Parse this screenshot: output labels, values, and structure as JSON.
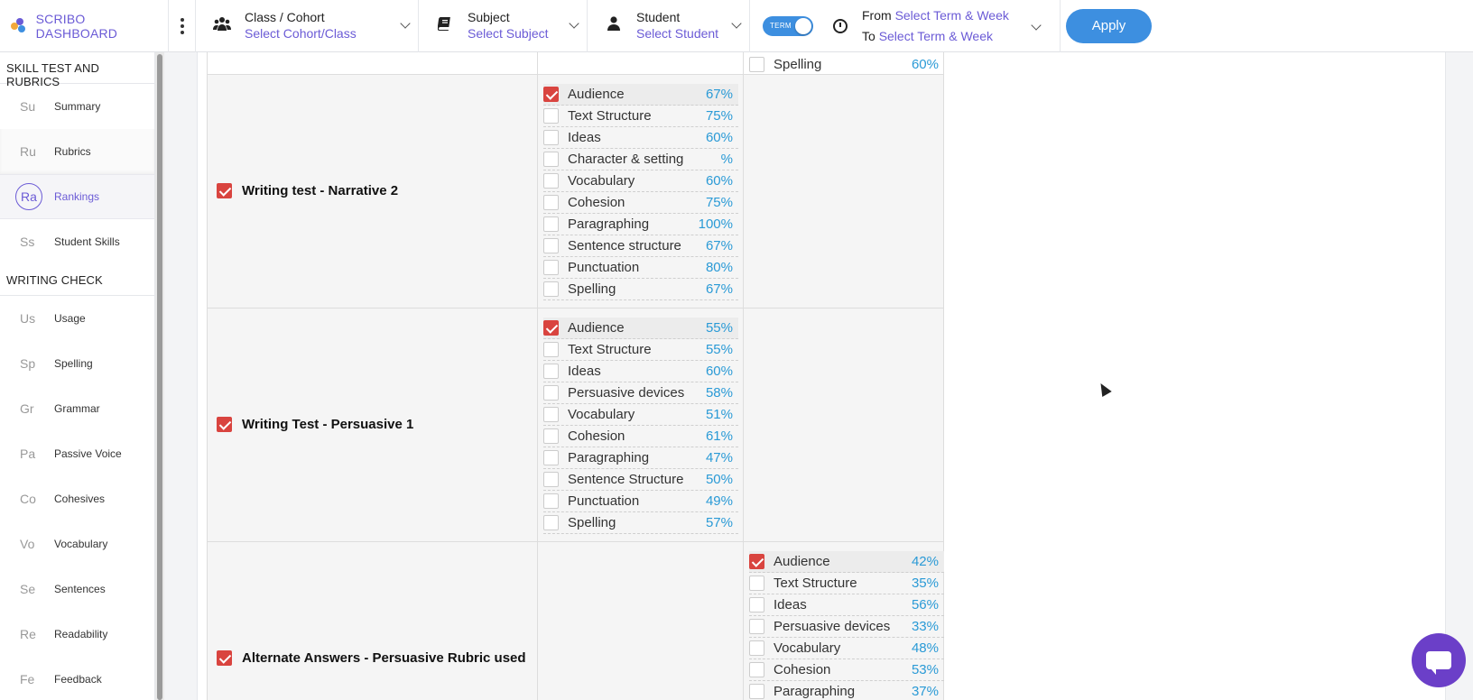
{
  "brand": {
    "name": "SCRIBO DASHBOARD"
  },
  "filters": {
    "class": {
      "label": "Class / Cohort",
      "value": "Select Cohort/Class"
    },
    "subject": {
      "label": "Subject",
      "value": "Select Subject"
    },
    "student": {
      "label": "Student",
      "value": "Select Student"
    },
    "toggle_label": "TERM",
    "from_label": "From",
    "from_value": "Select Term & Week",
    "to_label": "To",
    "to_value": "Select Term & Week",
    "apply_label": "Apply"
  },
  "sidebar": {
    "sections": [
      {
        "title": "SKILL TEST AND RUBRICS",
        "items": [
          {
            "abbr": "Su",
            "label": "Summary"
          },
          {
            "abbr": "Ru",
            "label": "Rubrics"
          },
          {
            "abbr": "Ra",
            "label": "Rankings"
          },
          {
            "abbr": "Ss",
            "label": "Student Skills"
          }
        ]
      },
      {
        "title": "WRITING CHECK",
        "items": [
          {
            "abbr": "Us",
            "label": "Usage"
          },
          {
            "abbr": "Sp",
            "label": "Spelling"
          },
          {
            "abbr": "Gr",
            "label": "Grammar"
          },
          {
            "abbr": "Pa",
            "label": "Passive Voice"
          },
          {
            "abbr": "Co",
            "label": "Cohesives"
          },
          {
            "abbr": "Vo",
            "label": "Vocabulary"
          },
          {
            "abbr": "Se",
            "label": "Sentences"
          },
          {
            "abbr": "Re",
            "label": "Readability"
          },
          {
            "abbr": "Fe",
            "label": "Feedback"
          }
        ]
      }
    ]
  },
  "top_partial": {
    "skill": "Spelling",
    "pct": "60%"
  },
  "tests": [
    {
      "name": "Writing test - Narrative 2",
      "checked": true,
      "column": 2,
      "skills": [
        {
          "name": "Audience",
          "pct": "67%",
          "checked": true
        },
        {
          "name": "Text Structure",
          "pct": "75%",
          "checked": false
        },
        {
          "name": "Ideas",
          "pct": "60%",
          "checked": false
        },
        {
          "name": "Character & setting",
          "pct": "%",
          "checked": false
        },
        {
          "name": "Vocabulary",
          "pct": "60%",
          "checked": false
        },
        {
          "name": "Cohesion",
          "pct": "75%",
          "checked": false
        },
        {
          "name": "Paragraphing",
          "pct": "100%",
          "checked": false
        },
        {
          "name": "Sentence structure",
          "pct": "67%",
          "checked": false
        },
        {
          "name": "Punctuation",
          "pct": "80%",
          "checked": false
        },
        {
          "name": "Spelling",
          "pct": "67%",
          "checked": false
        }
      ]
    },
    {
      "name": "Writing Test - Persuasive 1",
      "checked": true,
      "column": 2,
      "skills": [
        {
          "name": "Audience",
          "pct": "55%",
          "checked": true
        },
        {
          "name": "Text Structure",
          "pct": "55%",
          "checked": false
        },
        {
          "name": "Ideas",
          "pct": "60%",
          "checked": false
        },
        {
          "name": "Persuasive devices",
          "pct": "58%",
          "checked": false
        },
        {
          "name": "Vocabulary",
          "pct": "51%",
          "checked": false
        },
        {
          "name": "Cohesion",
          "pct": "61%",
          "checked": false
        },
        {
          "name": "Paragraphing",
          "pct": "47%",
          "checked": false
        },
        {
          "name": "Sentence Structure",
          "pct": "50%",
          "checked": false
        },
        {
          "name": "Punctuation",
          "pct": "49%",
          "checked": false
        },
        {
          "name": "Spelling",
          "pct": "57%",
          "checked": false
        }
      ]
    },
    {
      "name": "Alternate Answers - Persuasive Rubric used",
      "checked": true,
      "column": 3,
      "skills": [
        {
          "name": "Audience",
          "pct": "42%",
          "checked": true
        },
        {
          "name": "Text Structure",
          "pct": "35%",
          "checked": false
        },
        {
          "name": "Ideas",
          "pct": "56%",
          "checked": false
        },
        {
          "name": "Persuasive devices",
          "pct": "33%",
          "checked": false
        },
        {
          "name": "Vocabulary",
          "pct": "48%",
          "checked": false
        },
        {
          "name": "Cohesion",
          "pct": "53%",
          "checked": false
        },
        {
          "name": "Paragraphing",
          "pct": "37%",
          "checked": false
        }
      ]
    }
  ]
}
